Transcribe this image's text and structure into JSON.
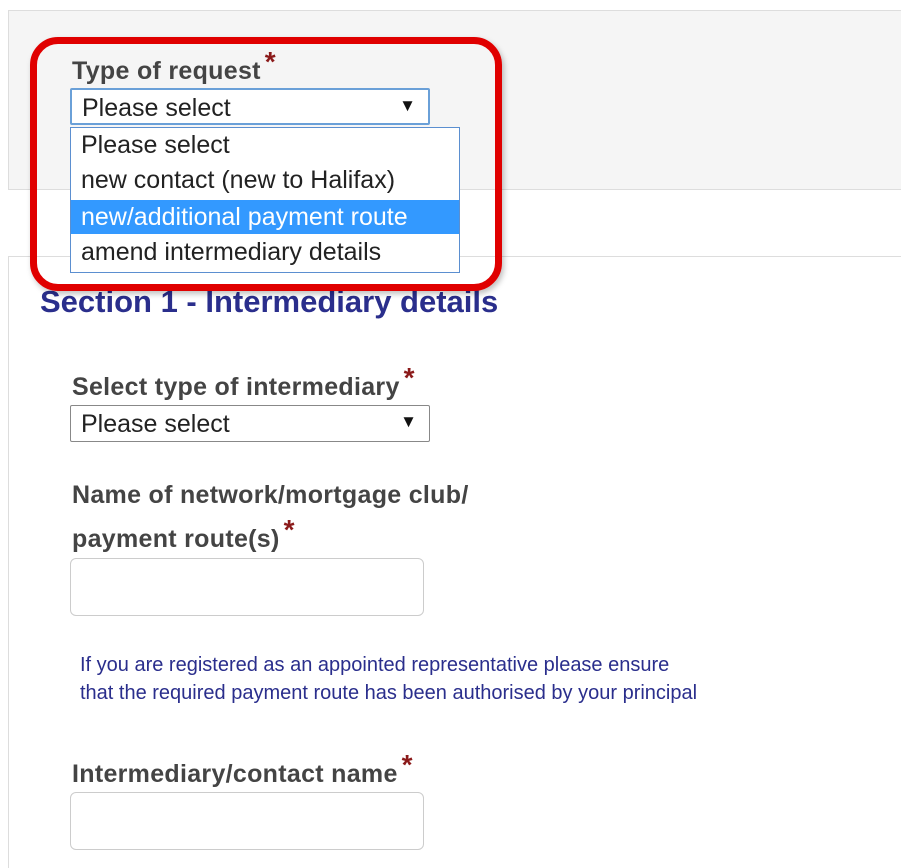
{
  "type_of_request": {
    "label": "Type of request",
    "required_marker": "*",
    "selected_value": "Please select",
    "options": [
      "Please select",
      "new contact (new to Halifax)",
      "new/additional payment route",
      "amend intermediary details"
    ],
    "highlighted_option": "new/additional payment route"
  },
  "section1": {
    "title": "Section 1 - Intermediary details",
    "intermediary_type": {
      "label": "Select type of intermediary",
      "required_marker": "*",
      "selected_value": "Please select"
    },
    "network_name": {
      "label_line1": "Name of network/mortgage club/",
      "label_line2": "payment route(s)",
      "required_marker": "*",
      "value": ""
    },
    "hint_line1": "If you are registered as an appointed representative please ensure",
    "hint_line2": "that the required payment route has been authorised by your principal",
    "contact_name": {
      "label": "Intermediary/contact name",
      "required_marker": "*",
      "value": ""
    }
  },
  "colors": {
    "required": "#8b1a1a",
    "section_title": "#2a2e8c",
    "option_highlight": "#3399ff",
    "callout": "#e00000"
  }
}
